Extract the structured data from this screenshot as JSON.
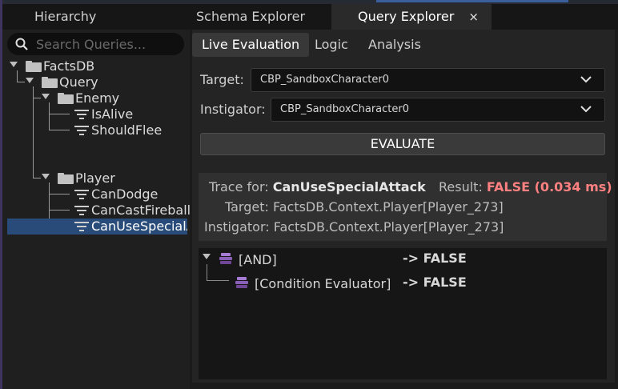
{
  "window_tabs": [
    {
      "label": "Hierarchy"
    },
    {
      "label": "Schema Explorer"
    },
    {
      "label": "Query Explorer",
      "active": true,
      "close": "×"
    }
  ],
  "search": {
    "placeholder": "Search Queries..."
  },
  "tree": {
    "factsdb": "FactsDB",
    "query": "Query",
    "enemy": "Enemy",
    "is_alive": "IsAlive",
    "should_flee": "ShouldFlee",
    "player": "Player",
    "can_dodge": "CanDodge",
    "can_cast_fireball": "CanCastFireball",
    "can_use_special_attack": "CanUseSpecialAttack",
    "selected": "CanUseSpecialAttack"
  },
  "sub_tabs": [
    "Live Evaluation",
    "Logic",
    "Analysis"
  ],
  "form": {
    "target_label": "Target:",
    "target_value": "CBP_SandboxCharacter0",
    "instigator_label": "Instigator:",
    "instigator_value": "CBP_SandboxCharacter0",
    "evaluate_label": "EVALUATE"
  },
  "trace": {
    "trace_for_label": "Trace for:",
    "trace_for_value": "CanUseSpecialAttack",
    "result_label": "Result:",
    "result_value": "FALSE (0.034 ms)",
    "target_label": "Target:",
    "target_value": "FactsDB.Context.Player[Player_273]",
    "instigator_label": "Instigator:",
    "instigator_value": "FactsDB.Context.Player[Player_273]"
  },
  "eval_tree": [
    {
      "label": "[AND]",
      "result": "-> FALSE"
    },
    {
      "label": "[Condition Evaluator]",
      "result": "-> FALSE"
    }
  ],
  "colors": {
    "selection": "#284b79",
    "false_result": "#ff8080",
    "node_icon": "#8a5fb8"
  }
}
